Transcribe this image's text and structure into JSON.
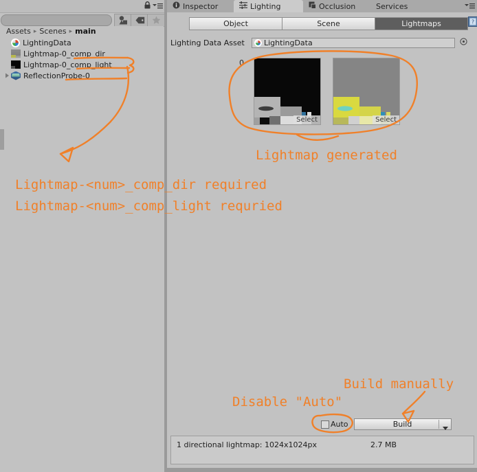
{
  "project_panel": {
    "toolbar_icons": [
      "lock-icon",
      "panel-menu-icon"
    ],
    "search_placeholder": "",
    "search_value": "",
    "buttons": [
      {
        "name": "filter-by-type-icon",
        "label": ""
      },
      {
        "name": "filter-by-label-icon",
        "label": ""
      },
      {
        "name": "favorites-star-icon",
        "label": ""
      }
    ],
    "breadcrumb": [
      "Assets",
      "Scenes",
      "main"
    ],
    "breadcrumb_separator": "▸",
    "assets": [
      {
        "label": "LightingData",
        "icon": "lighting-data-asset-icon",
        "expandable": false
      },
      {
        "label": "Lightmap-0_comp_dir",
        "icon": "texture-asset-icon",
        "expandable": false
      },
      {
        "label": "Lightmap-0_comp_light",
        "icon": "texture-asset-icon",
        "expandable": false
      },
      {
        "label": "ReflectionProbe-0",
        "icon": "reflection-probe-asset-icon",
        "expandable": true
      }
    ]
  },
  "inspector": {
    "tabs": [
      {
        "label": "Inspector",
        "icon": "info-icon",
        "active": false
      },
      {
        "label": "Lighting",
        "icon": "lighting-icon",
        "active": true
      },
      {
        "label": "Occlusion",
        "icon": "occlusion-icon",
        "active": false
      },
      {
        "label": "Services",
        "icon": "",
        "active": false
      }
    ],
    "tab_menu_icon": "panel-menu-icon",
    "segments": [
      {
        "label": "Object",
        "selected": false
      },
      {
        "label": "Scene",
        "selected": false
      },
      {
        "label": "Lightmaps",
        "selected": true
      }
    ],
    "help_icon": "help-book-icon",
    "lighting_data_asset": {
      "label": "Lighting Data Asset",
      "value": "LightingData",
      "object_icon": "lighting-data-asset-icon",
      "picker_icon": "object-picker-target-icon"
    },
    "lightmaps": {
      "index": "0",
      "entries": [
        {
          "name": "lightmap-directional-preview",
          "select_label": "Select"
        },
        {
          "name": "lightmap-light-preview",
          "select_label": "Select"
        }
      ]
    },
    "auto": {
      "label": "Auto",
      "checked": false
    },
    "build": {
      "label": "Build",
      "dropdown_icon": "chevron-down-icon"
    },
    "stats": {
      "line": "1 directional lightmap: 1024x1024px",
      "size": "2.7 MB"
    }
  },
  "annotations": {
    "color": "#F08029",
    "texts": [
      {
        "id": "asset-req-dir",
        "text": "Lightmap-<num>_comp_dir required"
      },
      {
        "id": "asset-req-light",
        "text": "Lightmap-<num>_comp_light requried"
      },
      {
        "id": "lightmap-gen",
        "text": "Lightmap generated"
      },
      {
        "id": "disable-auto",
        "text": "Disable \"Auto\""
      },
      {
        "id": "build-manually",
        "text": "Build manually"
      }
    ]
  }
}
